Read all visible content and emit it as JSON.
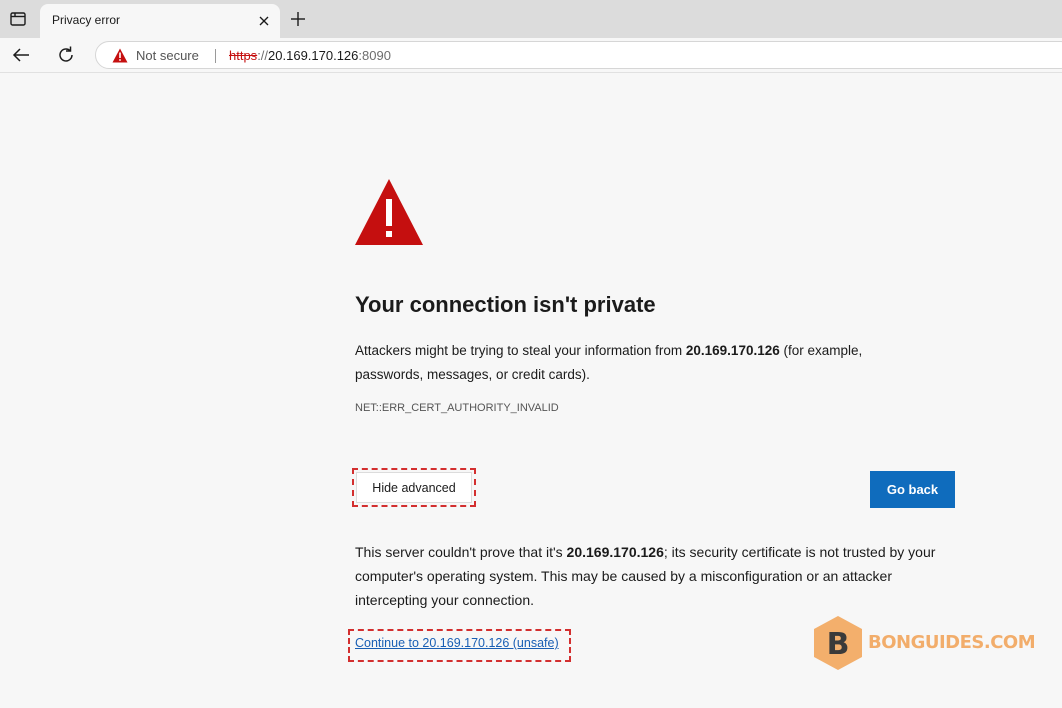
{
  "browser": {
    "tab": {
      "title": "Privacy error"
    },
    "address_bar": {
      "security_label": "Not secure",
      "url_scheme": "https",
      "url_separator": "://",
      "url_host": "20.169.170.126",
      "url_port": ":8090"
    }
  },
  "page": {
    "heading": "Your connection isn't private",
    "summary_before": "Attackers might be trying to steal your information from ",
    "summary_host": "20.169.170.126",
    "summary_after": " (for example, passwords, messages, or credit cards).",
    "error_code": "NET::ERR_CERT_AUTHORITY_INVALID",
    "hide_advanced_label": "Hide advanced",
    "go_back_label": "Go back",
    "details_before": "This server couldn't prove that it's ",
    "details_host": "20.169.170.126",
    "details_after": "; its security certificate is not trusted by your computer's operating system. This may be caused by a misconfiguration or an attacker intercepting your connection.",
    "continue_link": "Continue to 20.169.170.126 (unsafe)"
  },
  "watermark": {
    "text": "BONGUIDES.COM"
  },
  "colors": {
    "warning_red": "#c50f0f",
    "primary_button": "#0f6cbd",
    "link": "#1a5fb4",
    "annotation_dash": "#d32f2f",
    "watermark": "#f2a65c"
  }
}
